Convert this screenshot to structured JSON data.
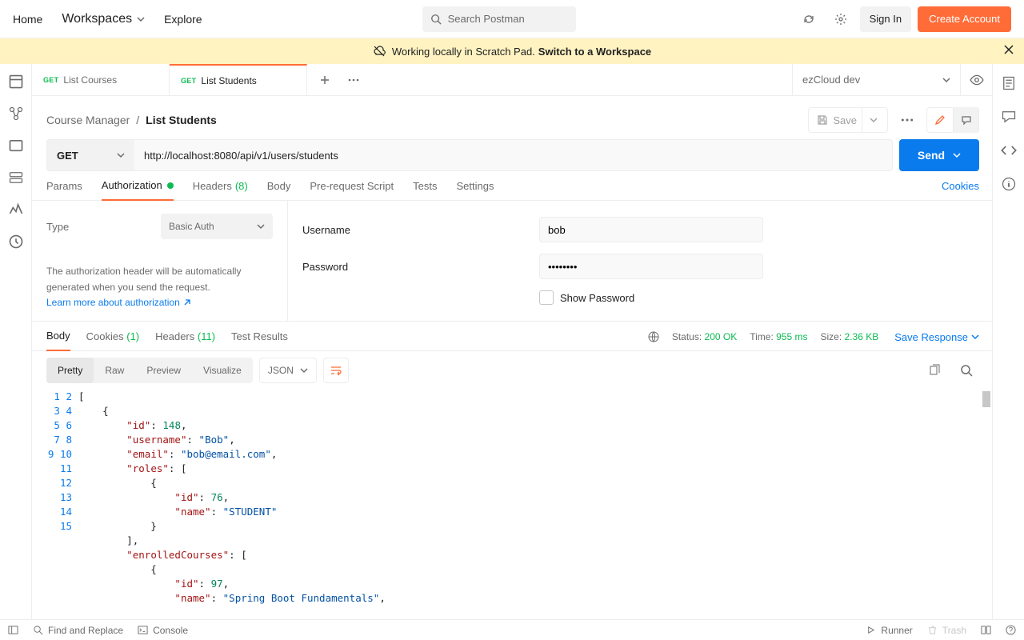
{
  "nav": {
    "home": "Home",
    "workspaces": "Workspaces",
    "explore": "Explore",
    "search_placeholder": "Search Postman",
    "sign_in": "Sign In",
    "create_account": "Create Account"
  },
  "banner": {
    "text": "Working locally in Scratch Pad.",
    "cta": "Switch to a Workspace"
  },
  "tabs": [
    {
      "method": "GET",
      "name": "List Courses",
      "active": false
    },
    {
      "method": "GET",
      "name": "List Students",
      "active": true
    }
  ],
  "env": {
    "name": "ezCloud dev"
  },
  "breadcrumb": {
    "parent": "Course Manager",
    "current": "List Students"
  },
  "actions": {
    "save": "Save"
  },
  "request": {
    "method": "GET",
    "url": "http://localhost:8080/api/v1/users/students",
    "send": "Send"
  },
  "reqtabs": {
    "params": "Params",
    "auth": "Authorization",
    "headers": "Headers",
    "headers_count": "(8)",
    "body": "Body",
    "prereq": "Pre-request Script",
    "tests": "Tests",
    "settings": "Settings",
    "cookies": "Cookies"
  },
  "auth": {
    "type_label": "Type",
    "type_value": "Basic Auth",
    "desc1": "The authorization header will be automatically generated when you send the request.",
    "learn": "Learn more about authorization",
    "username_label": "Username",
    "username_value": "bob",
    "password_label": "Password",
    "password_value": "••••••••",
    "show_pw": "Show Password"
  },
  "resptabs": {
    "body": "Body",
    "cookies": "Cookies",
    "cookies_count": "(1)",
    "headers": "Headers",
    "headers_count": "(11)",
    "testresults": "Test Results"
  },
  "respstatus": {
    "status_lbl": "Status:",
    "status_val": "200 OK",
    "time_lbl": "Time:",
    "time_val": "955 ms",
    "size_lbl": "Size:",
    "size_val": "2.36 KB",
    "save": "Save Response"
  },
  "viewmodes": {
    "pretty": "Pretty",
    "raw": "Raw",
    "preview": "Preview",
    "visualize": "Visualize",
    "format": "JSON"
  },
  "response_json": [
    {
      "id": 148,
      "username": "Bob",
      "email": "bob@email.com",
      "roles": [
        {
          "id": 76,
          "name": "STUDENT"
        }
      ],
      "enrolledCourses": [
        {
          "id": 97,
          "name": "Spring Boot Fundamentals"
        }
      ]
    }
  ],
  "code": {
    "lines": [
      "[",
      "    {",
      "        \"id\": 148,",
      "        \"username\": \"Bob\",",
      "        \"email\": \"bob@email.com\",",
      "        \"roles\": [",
      "            {",
      "                \"id\": 76,",
      "                \"name\": \"STUDENT\"",
      "            }",
      "        ],",
      "        \"enrolledCourses\": [",
      "            {",
      "                \"id\": 97,",
      "                \"name\": \"Spring Boot Fundamentals\","
    ]
  },
  "statusbar": {
    "sync": "",
    "find": "Find and Replace",
    "console": "Console",
    "runner": "Runner",
    "trash": "Trash"
  }
}
